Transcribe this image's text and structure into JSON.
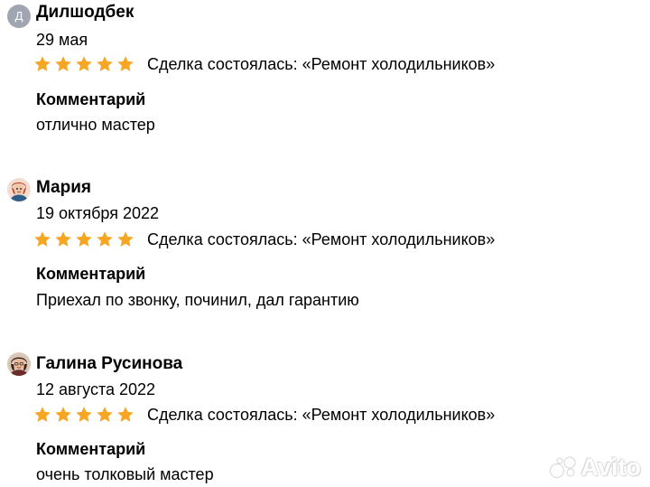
{
  "reviews": [
    {
      "avatar_letter": "Д",
      "author": "Дилшодбек",
      "date": "29 мая",
      "rating": 5,
      "deal": "Сделка состоялась: «Ремонт холодильников»",
      "comment_label": "Комментарий",
      "comment": "отлично мастер"
    },
    {
      "author": "Мария",
      "date": "19 октября 2022",
      "rating": 5,
      "deal": "Сделка состоялась: «Ремонт холодильников»",
      "comment_label": "Комментарий",
      "comment": "Приехал по звонку, починил, дал гарантию"
    },
    {
      "author": "Галина Русинова",
      "date": "12 августа 2022",
      "rating": 5,
      "deal": "Сделка состоялась: «Ремонт холодильников»",
      "comment_label": "Комментарий",
      "comment": "очень толковый мастер"
    }
  ],
  "watermark": "Avito",
  "colors": {
    "star": "#f7a623",
    "text": "#000000",
    "avatar_letter_bg": "#9fa6b2"
  },
  "icons": {
    "star": "star-icon",
    "watermark": "avito-logo-icon"
  }
}
